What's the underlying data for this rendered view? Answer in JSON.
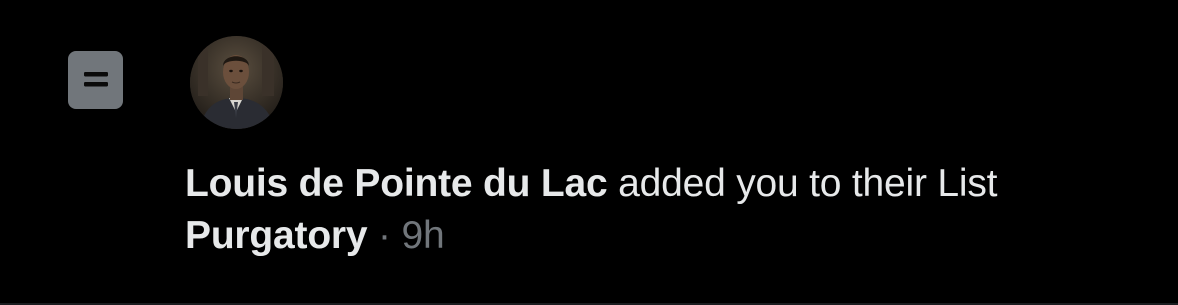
{
  "notification": {
    "icon": "list-icon",
    "user_name": "Louis de Pointe du Lac",
    "action_text": "added you to their List",
    "list_name": "Purgatory",
    "separator": "·",
    "timestamp": "9h",
    "avatar": "profile-photo"
  },
  "colors": {
    "background": "#000000",
    "text_primary": "#e7e9ea",
    "text_secondary": "#71767b",
    "badge_background": "#71767b",
    "divider": "#1b1d20"
  }
}
